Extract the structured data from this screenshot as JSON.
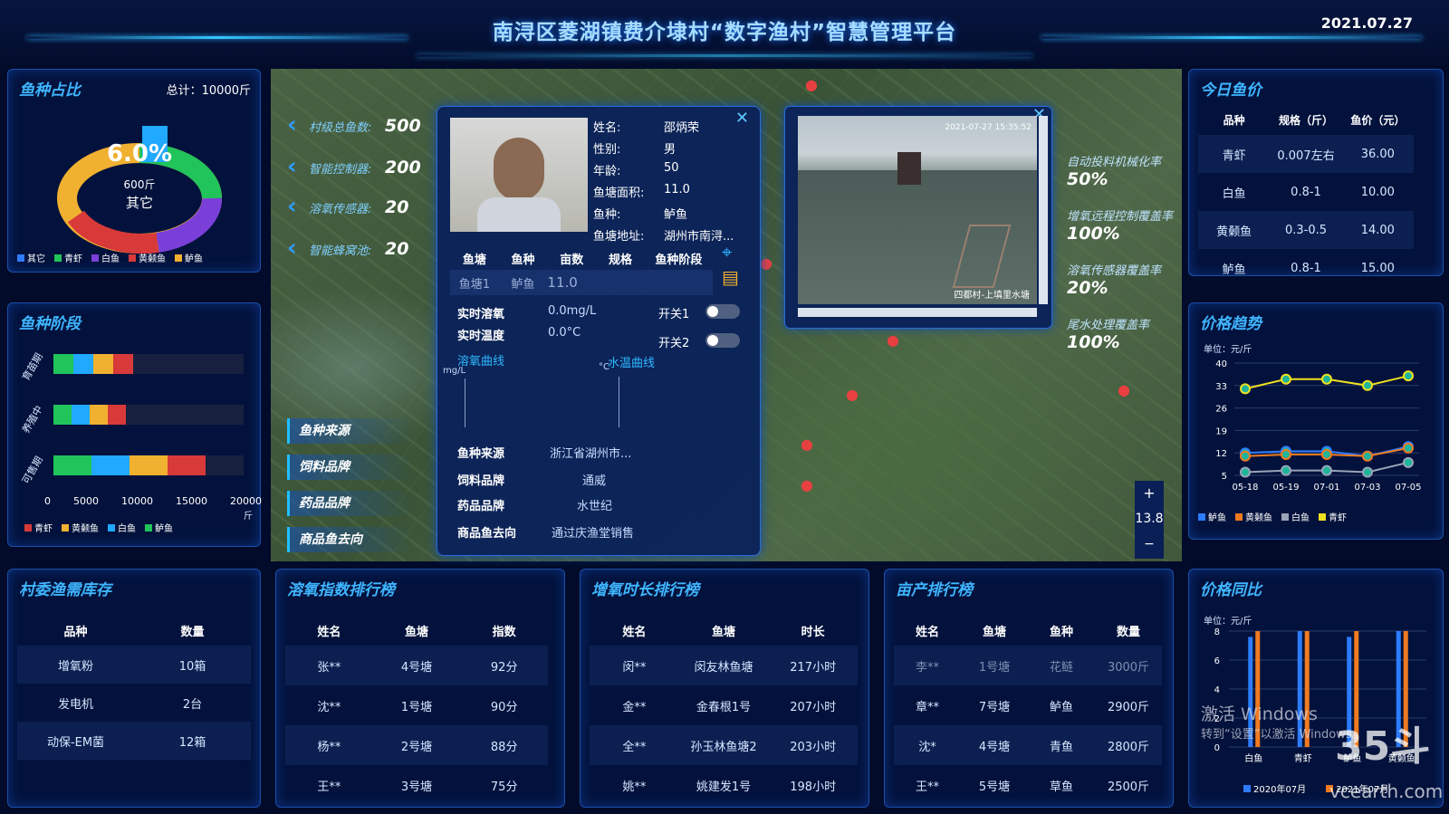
{
  "header": {
    "title": "南浔区菱湖镇费介埭村“数字渔村”智慧管理平台",
    "date": "2021.07.27"
  },
  "species_ratio": {
    "title": "鱼种占比",
    "total": "总计：10000斤",
    "center_pct": "6.0%",
    "center_weight": "600斤",
    "center_label": "其它",
    "legend": [
      "其它",
      "青虾",
      "白鱼",
      "黄颡鱼",
      "鲈鱼"
    ],
    "colors": [
      "#2d7cff",
      "#21c45a",
      "#7a3fd8",
      "#d83a3a",
      "#f0b030"
    ]
  },
  "species_stage": {
    "title": "鱼种阶段",
    "rows": [
      "育苗期",
      "养殖中",
      "可售期"
    ],
    "xticks": [
      "0",
      "5000",
      "10000",
      "15000",
      "20000"
    ],
    "unit": "斤",
    "legend": [
      "青虾",
      "黄颡鱼",
      "白鱼",
      "鲈鱼"
    ]
  },
  "map": {
    "stats": [
      {
        "label": "村级总鱼数:",
        "value": "500"
      },
      {
        "label": "智能控制器:",
        "value": "200"
      },
      {
        "label": "溶氧传感器:",
        "value": "20"
      },
      {
        "label": "智能蜂窝池:",
        "value": "20"
      }
    ],
    "tags": [
      "鱼种来源",
      "饲料品牌",
      "药品品牌",
      "商品鱼去向"
    ],
    "rates": [
      {
        "label": "自动投料机械化率",
        "value": "50%"
      },
      {
        "label": "增氧远程控制覆盖率",
        "value": "100%"
      },
      {
        "label": "溶氧传感器覆盖率",
        "value": "20%"
      },
      {
        "label": "尾水处理覆盖率",
        "value": "100%"
      }
    ],
    "zoom_in": "+",
    "zoom": "13.8",
    "zoom_out": "−"
  },
  "farmer": {
    "name_k": "姓名:",
    "name": "邵炳荣",
    "gender_k": "性别:",
    "gender": "男",
    "age_k": "年龄:",
    "age": "50",
    "area_k": "鱼塘面积:",
    "area": "11.0",
    "species_k": "鱼种:",
    "species": "鲈鱼",
    "addr_k": "鱼塘地址:",
    "addr": "湖州市南浔...",
    "pond_headers": [
      "鱼塘",
      "鱼种",
      "亩数",
      "规格",
      "鱼种阶段"
    ],
    "pond_row": [
      "鱼塘1",
      "鲈鱼",
      "11.0"
    ],
    "oxygen_k": "实时溶氧",
    "oxygen": "0.0mg/L",
    "temp_k": "实时温度",
    "temp": "0.0°C",
    "switch1": "开关1",
    "switch2": "开关2",
    "oxy_curve": "溶氧曲线",
    "oxy_unit": "mg/L",
    "temp_curve": "水温曲线",
    "temp_unit": "°C",
    "source_k": "鱼种来源",
    "source": "浙江省湖州市...",
    "feed_k": "饲料品牌",
    "feed": "通威",
    "medicine_k": "药品品牌",
    "medicine": "水世纪",
    "dest_k": "商品鱼去向",
    "dest": "通过庆渔堂销售"
  },
  "video": {
    "timestamp": "2021-07-27 15:35:52",
    "caption": "四都村-上填里水塘"
  },
  "price_today": {
    "title": "今日鱼价",
    "headers": [
      "品种",
      "规格（斤）",
      "鱼价（元）"
    ],
    "rows": [
      [
        "青虾",
        "0.007左右",
        "36.00"
      ],
      [
        "白鱼",
        "0.8-1",
        "10.00"
      ],
      [
        "黄颡鱼",
        "0.3-0.5",
        "14.00"
      ],
      [
        "鲈鱼",
        "0.8-1",
        "15.00"
      ]
    ]
  },
  "price_trend": {
    "title": "价格趋势",
    "unit": "单位：元/斤",
    "chart_data": {
      "type": "line",
      "x": [
        "05-18",
        "05-19",
        "07-01",
        "07-03",
        "07-05"
      ],
      "ylim": [
        5,
        40
      ],
      "yticks": [
        5,
        12,
        19,
        26,
        33,
        40
      ],
      "series": [
        {
          "name": "鲈鱼",
          "color": "#2d7cff",
          "values": [
            12,
            12.5,
            12.5,
            11,
            14
          ]
        },
        {
          "name": "黄颡鱼",
          "color": "#f07a20",
          "values": [
            11,
            11.5,
            11.5,
            11,
            13.5
          ]
        },
        {
          "name": "白鱼",
          "color": "#9aa4b8",
          "values": [
            6,
            6.5,
            6.5,
            6,
            9
          ]
        },
        {
          "name": "青虾",
          "color": "#f0e020",
          "values": [
            32,
            35,
            35,
            33,
            36
          ]
        }
      ]
    },
    "legend": [
      "鲈鱼",
      "黄颡鱼",
      "白鱼",
      "青虾"
    ]
  },
  "price_yoy": {
    "title": "价格同比",
    "unit": "单位：元/斤",
    "chart_data": {
      "type": "bar",
      "categories": [
        "白鱼",
        "青虾",
        "鲈鱼",
        "黄颡鱼"
      ],
      "ylim": [
        0,
        8
      ],
      "yticks": [
        0,
        2,
        4,
        6,
        8
      ],
      "series": [
        {
          "name": "2020年07月",
          "color": "#2d7cff",
          "values": [
            7.6,
            8,
            7.6,
            8
          ]
        },
        {
          "name": "2021年07月",
          "color": "#f07a20",
          "values": [
            8,
            8,
            8,
            8
          ]
        }
      ]
    },
    "legend": [
      "2020年07月",
      "2021年07月"
    ]
  },
  "inventory": {
    "title": "村委渔需库存",
    "headers": [
      "品种",
      "数量"
    ],
    "rows": [
      [
        "增氧粉",
        "10箱"
      ],
      [
        "发电机",
        "2台"
      ],
      [
        "动保-EM菌",
        "12箱"
      ]
    ]
  },
  "oxygen_rank": {
    "title": "溶氧指数排行榜",
    "headers": [
      "姓名",
      "鱼塘",
      "指数"
    ],
    "rows": [
      [
        "张**",
        "4号塘",
        "92分"
      ],
      [
        "沈**",
        "1号塘",
        "90分"
      ],
      [
        "杨**",
        "2号塘",
        "88分"
      ],
      [
        "王**",
        "3号塘",
        "75分"
      ]
    ]
  },
  "aeration_rank": {
    "title": "增氧时长排行榜",
    "headers": [
      "姓名",
      "鱼塘",
      "时长"
    ],
    "rows": [
      [
        "闵**",
        "闵友林鱼塘",
        "217小时"
      ],
      [
        "金**",
        "金春根1号",
        "207小时"
      ],
      [
        "全**",
        "孙玉林鱼塘2",
        "203小时"
      ],
      [
        "姚**",
        "姚建发1号",
        "198小时"
      ]
    ]
  },
  "yield_rank": {
    "title": "亩产排行榜",
    "headers": [
      "姓名",
      "鱼塘",
      "鱼种",
      "数量"
    ],
    "rows": [
      [
        "李**",
        "1号塘",
        "花鲢",
        "3000斤"
      ],
      [
        "章**",
        "7号塘",
        "鲈鱼",
        "2900斤"
      ],
      [
        "沈*",
        "4号塘",
        "青鱼",
        "2800斤"
      ],
      [
        "王**",
        "5号塘",
        "草鱼",
        "2500斤"
      ]
    ]
  },
  "watermark": {
    "line1": "激活 Windows",
    "line2": "转到“设置”以激活 Windows。",
    "logo": "35斗",
    "site": "vcearth.com"
  }
}
